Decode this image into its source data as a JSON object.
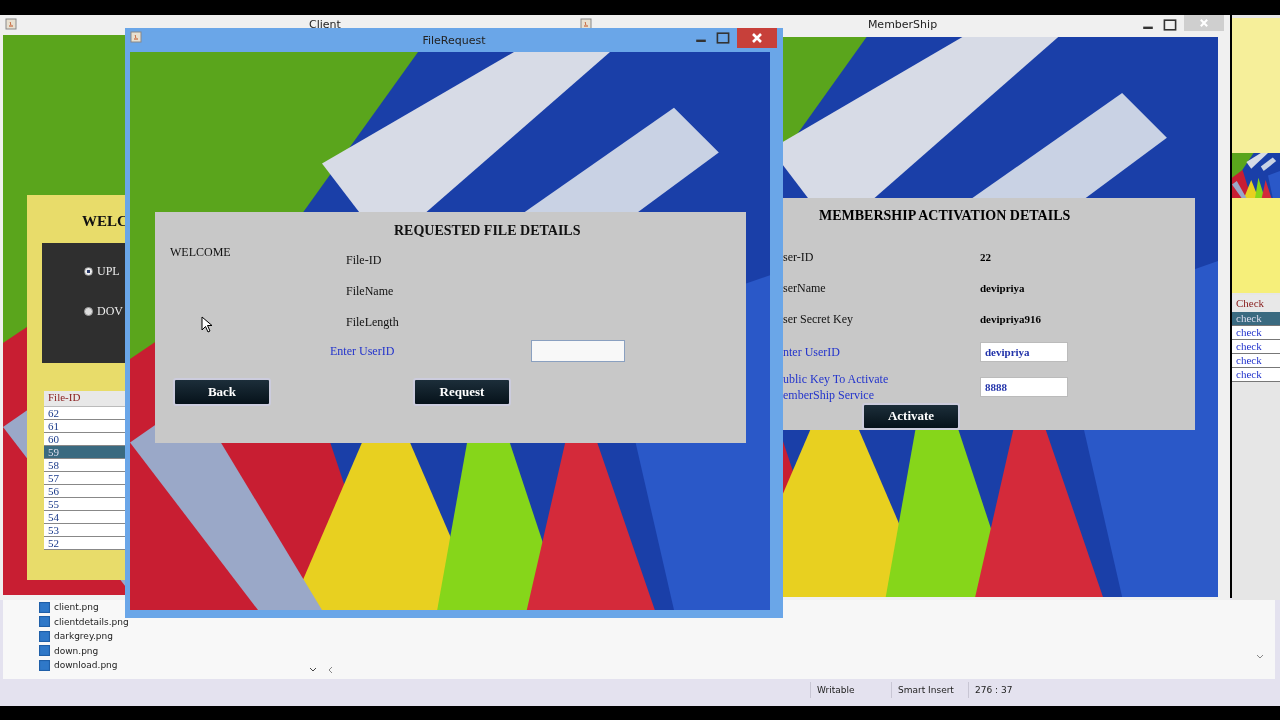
{
  "ide": {
    "files": [
      "client.png",
      "clientdetails.png",
      "darkgrey.png",
      "down.png",
      "download.png"
    ],
    "status_bar": [
      "Writable",
      "Smart Insert",
      "276 : 37"
    ]
  },
  "client_window": {
    "title": "Client",
    "heading": "WELC",
    "options": [
      {
        "label": "UPL",
        "selected": true
      },
      {
        "label": "DOV",
        "selected": false
      }
    ],
    "table": {
      "columns": [
        "File-ID"
      ],
      "rows": [
        {
          "cells": [
            "62"
          ],
          "selected": false
        },
        {
          "cells": [
            "61"
          ],
          "selected": false
        },
        {
          "cells": [
            "60"
          ],
          "selected": false
        },
        {
          "cells": [
            "59"
          ],
          "selected": true
        },
        {
          "cells": [
            "58"
          ],
          "selected": false
        },
        {
          "cells": [
            "57"
          ],
          "selected": false
        },
        {
          "cells": [
            "56"
          ],
          "selected": false
        },
        {
          "cells": [
            "55"
          ],
          "selected": false
        },
        {
          "cells": [
            "54"
          ],
          "selected": false
        },
        {
          "cells": [
            "53"
          ],
          "selected": false
        },
        {
          "cells": [
            "52"
          ],
          "selected": false
        }
      ]
    }
  },
  "membership_window": {
    "title": "MemberShip",
    "heading": "MEMBERSHIP ACTIVATION DETAILS",
    "details": [
      {
        "label": "ser-ID",
        "value": "22"
      },
      {
        "label": "serName",
        "value": "devipriya"
      },
      {
        "label": "ser Secret Key",
        "value": "devipriya916"
      }
    ],
    "fields": [
      {
        "label_lines": [
          "nter UserID"
        ],
        "value": "devipriya"
      },
      {
        "label_lines": [
          "ublic Key To Activate",
          "emberShip Service"
        ],
        "value": "8888"
      }
    ],
    "button": "Activate"
  },
  "right_window": {
    "table": {
      "columns": [
        "Check"
      ],
      "rows": [
        {
          "cells": [
            "check"
          ],
          "selected": true
        },
        {
          "cells": [
            "check"
          ],
          "selected": false
        },
        {
          "cells": [
            "check"
          ],
          "selected": false
        },
        {
          "cells": [
            "check"
          ],
          "selected": false
        },
        {
          "cells": [
            "check"
          ],
          "selected": false
        }
      ]
    }
  },
  "file_request_window": {
    "title": "FileRequest",
    "heading": "REQUESTED FILE DETAILS",
    "welcome": "WELCOME",
    "details": [
      "File-ID",
      "FileName",
      "FileLength"
    ],
    "field": {
      "label": "Enter UserID"
    },
    "buttons": [
      "Back",
      "Request"
    ]
  }
}
